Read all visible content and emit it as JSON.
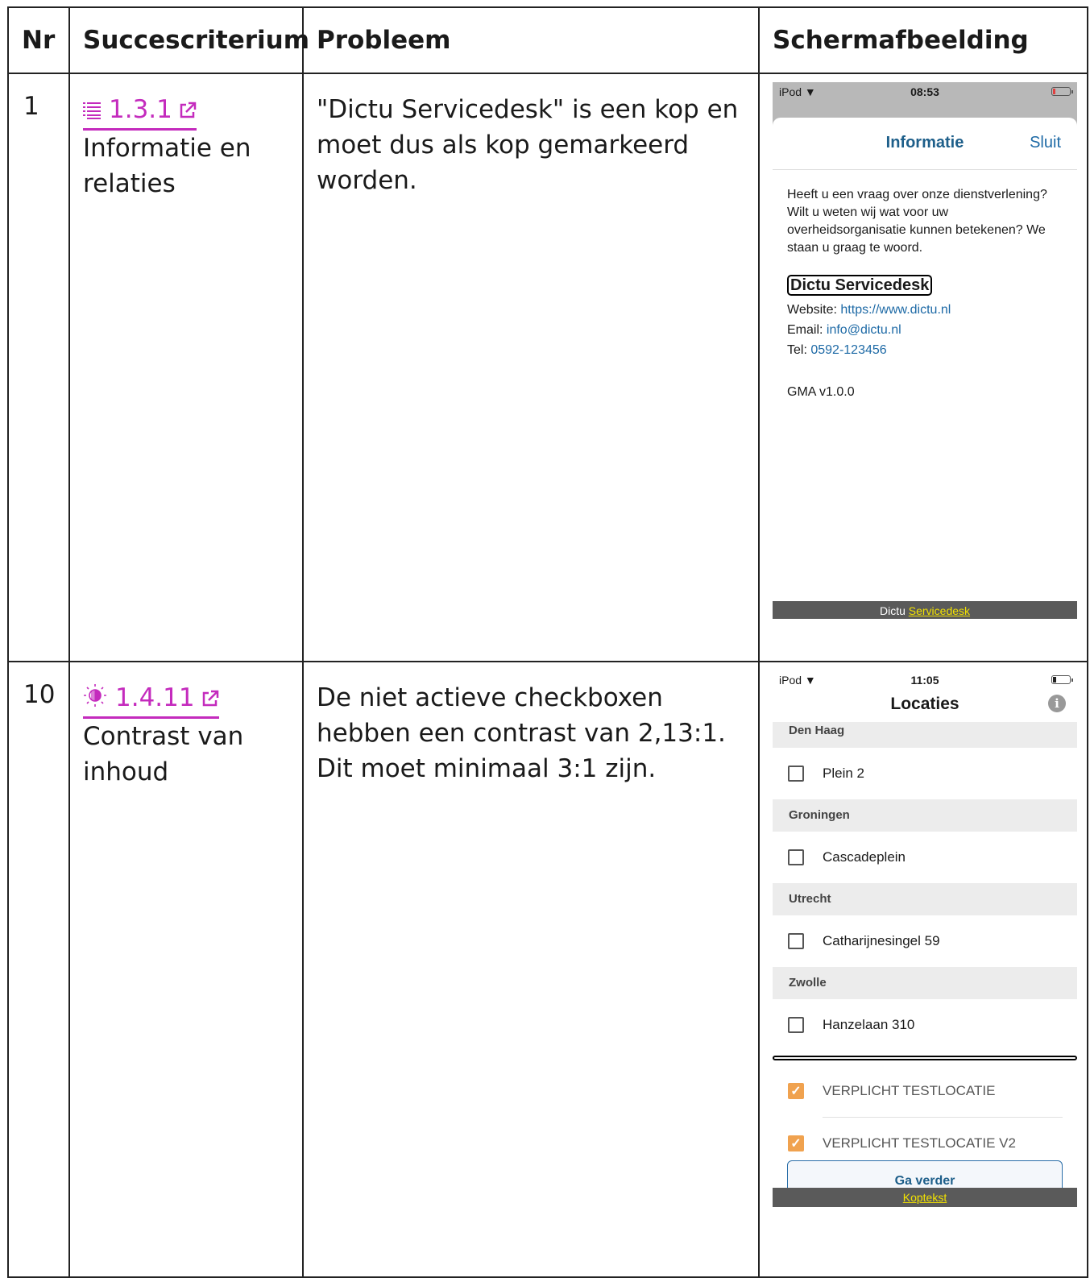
{
  "table": {
    "headers": [
      "Nr",
      "Succescriterium",
      "Probleem",
      "Schermafbeelding"
    ]
  },
  "rows": [
    {
      "nr": "1",
      "sc_icon": "list-icon",
      "sc_code": "1.3.1",
      "sc_name": "Informatie en relaties",
      "problem": "\"Dictu Servicedesk\" is een kop en moet dus als kop gemarkeerd worden.",
      "screenshot": {
        "device": "iPod",
        "time": "08:53",
        "sheet_title": "Informatie",
        "close_label": "Sluit",
        "intro": "Heeft u een vraag over onze dienstverlening? Wilt u weten wij wat voor uw overheidsorganisatie kunnen betekenen? We staan u graag te woord.",
        "heading": "Dictu Servicedesk",
        "website_label": "Website:",
        "website_value": "https://www.dictu.nl",
        "email_label": "Email:",
        "email_value": "info@dictu.nl",
        "tel_label": "Tel:",
        "tel_value": "0592-123456",
        "version": "GMA v1.0.0",
        "footer_plain": "Dictu",
        "footer_link": "Servicedesk"
      }
    },
    {
      "nr": "10",
      "sc_icon": "contrast-icon",
      "sc_code": "1.4.11",
      "sc_name": "Contrast van inhoud",
      "problem": "De niet actieve checkboxen hebben een contrast van 2,13:1. Dit moet minimaal 3:1 zijn.",
      "screenshot": {
        "device": "iPod",
        "time": "11:05",
        "title": "Locaties",
        "sections": [
          {
            "name": "Den Haag",
            "items": [
              "Plein 2"
            ]
          },
          {
            "name": "Groningen",
            "items": [
              "Cascadeplein"
            ]
          },
          {
            "name": "Utrecht",
            "items": [
              "Catharijnesingel 59"
            ]
          },
          {
            "name": "Zwolle",
            "items": [
              "Hanzelaan 310"
            ]
          }
        ],
        "checked_items": [
          "VERPLICHT TESTLOCATIE",
          "VERPLICHT TESTLOCATIE V2"
        ],
        "button_label": "Ga verder",
        "footer_link": "Koptekst"
      }
    }
  ],
  "colors": {
    "link": "#c42bbd",
    "checked": "#f0a24f",
    "accent_blue": "#1e5f8a"
  }
}
